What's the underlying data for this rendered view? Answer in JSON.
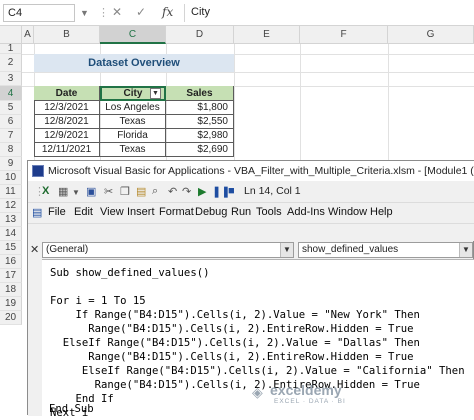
{
  "excel": {
    "name_box": "C4",
    "formula_value": "City",
    "columns": [
      "A",
      "B",
      "C",
      "D",
      "E",
      "F",
      "G"
    ],
    "rows": [
      "1",
      "2",
      "3",
      "4",
      "5",
      "6",
      "7",
      "8",
      "9",
      "10",
      "11",
      "12",
      "13",
      "14",
      "15",
      "16",
      "17",
      "18",
      "19",
      "20"
    ],
    "dataset_title": "Dataset Overview",
    "table": {
      "headers": [
        "Date",
        "City",
        "Sales"
      ],
      "rows": [
        [
          "12/3/2021",
          "Los Angeles",
          "$1,800"
        ],
        [
          "12/8/2021",
          "Texas",
          "$2,550"
        ],
        [
          "12/9/2021",
          "Florida",
          "$2,980"
        ],
        [
          "12/11/2021",
          "Texas",
          "$2,690"
        ]
      ]
    }
  },
  "vbe": {
    "title": "Microsoft Visual Basic for Applications - VBA_Filter_with_Multiple_Criteria.xlsm - [Module1 (Code)]",
    "cursor_position": "Ln 14, Col 1",
    "menu": [
      "File",
      "Edit",
      "View",
      "Insert",
      "Format",
      "Debug",
      "Run",
      "Tools",
      "Add-Ins",
      "Window",
      "Help"
    ],
    "object_combo": "(General)",
    "procedure_combo": "show_defined_values",
    "code_lines": [
      "Sub show_defined_values()",
      "",
      "For i = 1 To 15",
      "    If Range(\"B4:D15\").Cells(i, 2).Value = \"New York\" Then",
      "      Range(\"B4:D15\").Cells(i, 2).EntireRow.Hidden = True",
      "  ElseIf Range(\"B4:D15\").Cells(i, 2).Value = \"Dallas\" Then",
      "      Range(\"B4:D15\").Cells(i, 2).EntireRow.Hidden = True",
      "     ElseIf Range(\"B4:D15\").Cells(i, 2).Value = \"California\" Then",
      "       Range(\"B4:D15\").Cells(i, 2).EntireRow.Hidden = True",
      "    End If",
      "Next i",
      "",
      "End Sub"
    ]
  },
  "watermark": {
    "brand": "exceldemy",
    "tagline": "EXCEL · DATA · BI"
  }
}
